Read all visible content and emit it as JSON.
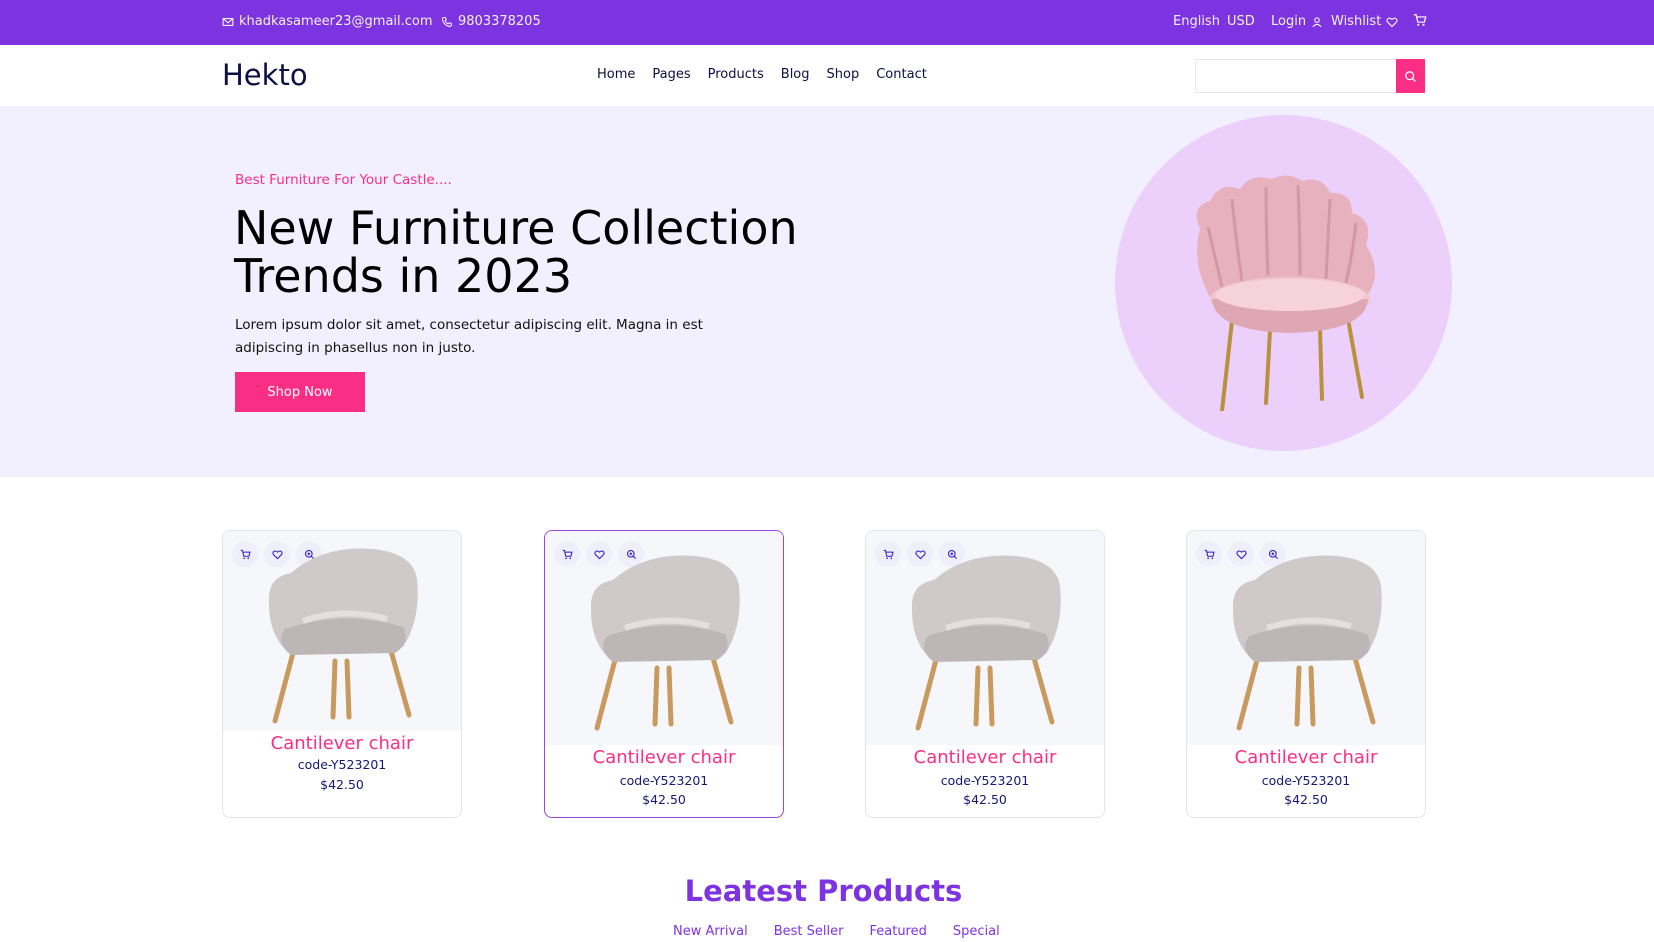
{
  "topbar": {
    "email": "khadkasameer23@gmail.com",
    "phone": "9803378205",
    "language": "English",
    "currency": "USD",
    "login": "Login",
    "wishlist": "Wishlist"
  },
  "header": {
    "logo": "Hekto",
    "nav": [
      "Home",
      "Pages",
      "Products",
      "Blog",
      "Shop",
      "Contact"
    ],
    "search_placeholder": ""
  },
  "hero": {
    "subtitle": "Best Furniture For Your Castle....",
    "title": "New Furniture Collection Trends in 2023",
    "description": "Lorem ipsum dolor sit amet, consectetur adipiscing elit. Magna in est adipiscing in phasellus non in justo.",
    "button": "Shop Now"
  },
  "products": [
    {
      "name": "Cantilever chair",
      "code": "code-Y523201",
      "price": "$42.50"
    },
    {
      "name": "Cantilever chair",
      "code": "code-Y523201",
      "price": "$42.50"
    },
    {
      "name": "Cantilever chair",
      "code": "code-Y523201",
      "price": "$42.50"
    },
    {
      "name": "Cantilever chair",
      "code": "code-Y523201",
      "price": "$42.50"
    }
  ],
  "latest": {
    "title": "Leatest Products",
    "tabs": [
      "New Arrival",
      "Best Seller",
      "Featured",
      "Special"
    ]
  },
  "colors": {
    "topbar": "#7e33e0",
    "accent_pink": "#fb2e86",
    "hero_bg": "#f2f0ff",
    "circle": "#ecd0fb",
    "navy": "#151875"
  },
  "icons": [
    "mail-icon",
    "phone-icon",
    "user-icon",
    "heart-icon",
    "cart-icon",
    "search-icon",
    "zoom-icon"
  ]
}
